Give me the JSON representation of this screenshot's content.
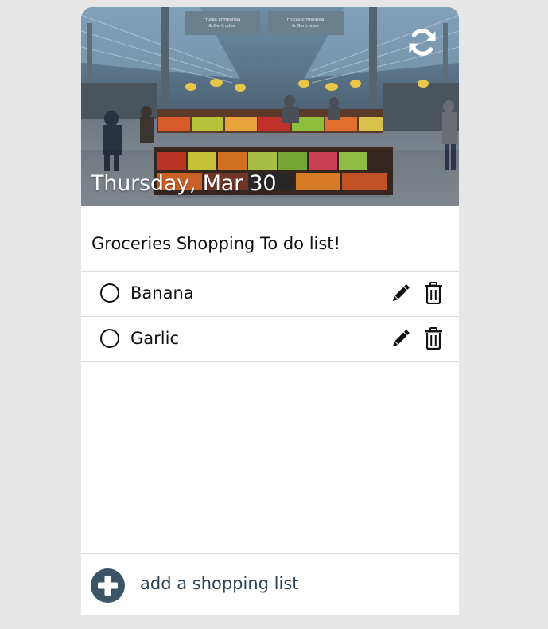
{
  "header": {
    "date": "Thursday, Mar 30",
    "image_alt": "Frutas Ermelinda & Gertrudes market stall",
    "stall_sign_left": "Frutas Ermelinda & Gertrudes",
    "stall_sign_right": "Frutas Ermelinda & Gertrudes",
    "refresh_icon": "refresh-icon"
  },
  "list": {
    "title": "Groceries Shopping To do list!",
    "items": [
      {
        "label": "Banana",
        "done": false
      },
      {
        "label": "Garlic",
        "done": false
      }
    ]
  },
  "footer": {
    "add_label": "add a shopping list",
    "add_icon": "plus-circle-icon"
  },
  "colors": {
    "page_background": "#e6e6e6",
    "card_background": "#ffffff",
    "accent": "#3b5466",
    "divider": "#dcdcdc"
  }
}
